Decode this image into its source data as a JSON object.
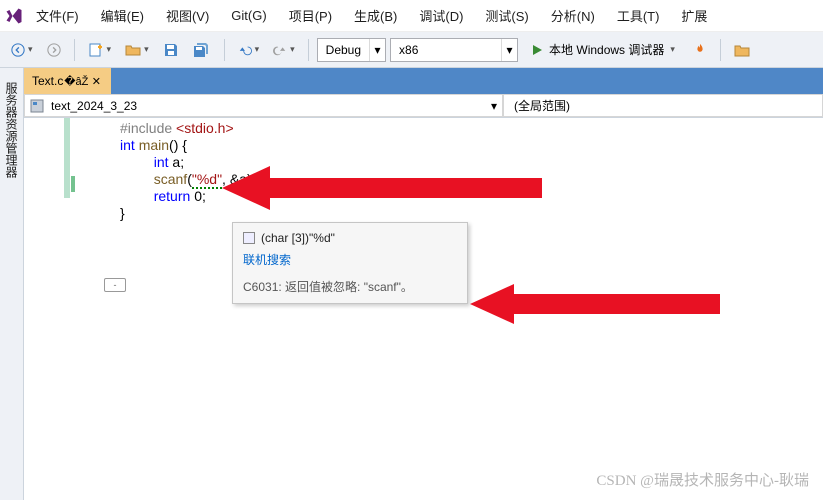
{
  "menu": [
    "文件(F)",
    "编辑(E)",
    "视图(V)",
    "Git(G)",
    "项目(P)",
    "生成(B)",
    "调试(D)",
    "测试(S)",
    "分析(N)",
    "工具(T)",
    "扩展"
  ],
  "toolbar": {
    "config": "Debug",
    "platform": "x86",
    "run_label": "本地 Windows 调试器"
  },
  "sidebar": {
    "panel_label": "服务器资源管理器"
  },
  "tab": {
    "filename": "Text.c"
  },
  "nav": {
    "scope": "text_2024_3_23",
    "right": "(全局范围)"
  },
  "code": {
    "l1_pre": "#include ",
    "l1_inc": "<stdio.h>",
    "l2_kw1": "int ",
    "l2_fn": "main",
    "l2_rest": "() {",
    "l3_kw": "int ",
    "l3_rest": "a;",
    "l4_fn": "scanf",
    "l4_p": "(",
    "l4_str": "\"%d\"",
    "l4_mid": ", &a)",
    "l4_end": ";",
    "l5_kw": "return ",
    "l5_rest": "0;",
    "l6": "}"
  },
  "tooltip": {
    "type_text": "(char [3])\"%d\"",
    "search": "联机搜索",
    "warn": "C6031: 返回值被忽略: \"scanf\"。"
  },
  "outline_collapse": "-",
  "watermark": "CSDN @瑞晟技术服务中心-耿瑞"
}
